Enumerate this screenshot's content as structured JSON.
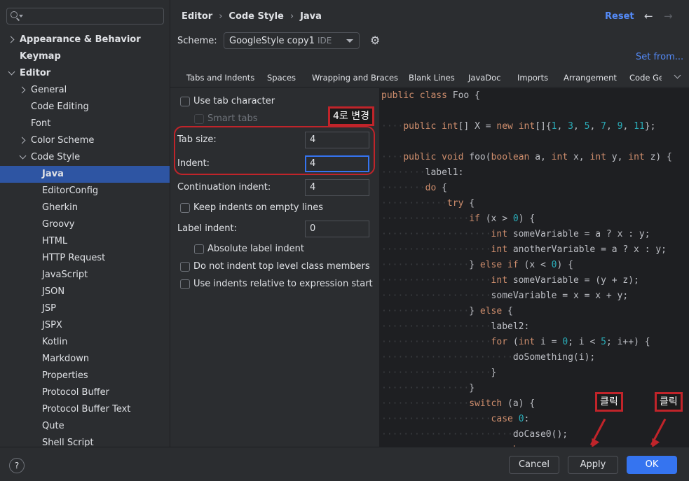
{
  "search": {
    "placeholder": ""
  },
  "sidebar": {
    "items": [
      {
        "label": "Appearance & Behavior",
        "bold": true,
        "chevron": "right",
        "level": 0
      },
      {
        "label": "Keymap",
        "bold": true,
        "chevron": "none",
        "level": 0
      },
      {
        "label": "Editor",
        "bold": true,
        "chevron": "down",
        "level": 0
      },
      {
        "label": "General",
        "chevron": "right",
        "level": 1
      },
      {
        "label": "Code Editing",
        "chevron": "none",
        "level": 1
      },
      {
        "label": "Font",
        "chevron": "none",
        "level": 1
      },
      {
        "label": "Color Scheme",
        "chevron": "right",
        "level": 1
      },
      {
        "label": "Code Style",
        "chevron": "down",
        "level": 1
      },
      {
        "label": "Java",
        "chevron": "none",
        "level": 2,
        "selected": true,
        "bold": true
      },
      {
        "label": "EditorConfig",
        "level": 2
      },
      {
        "label": "Gherkin",
        "level": 2
      },
      {
        "label": "Groovy",
        "level": 2
      },
      {
        "label": "HTML",
        "level": 2
      },
      {
        "label": "HTTP Request",
        "level": 2
      },
      {
        "label": "JavaScript",
        "level": 2
      },
      {
        "label": "JSON",
        "level": 2
      },
      {
        "label": "JSP",
        "level": 2
      },
      {
        "label": "JSPX",
        "level": 2
      },
      {
        "label": "Kotlin",
        "level": 2
      },
      {
        "label": "Markdown",
        "level": 2
      },
      {
        "label": "Properties",
        "level": 2
      },
      {
        "label": "Protocol Buffer",
        "level": 2
      },
      {
        "label": "Protocol Buffer Text",
        "level": 2
      },
      {
        "label": "Qute",
        "level": 2
      },
      {
        "label": "Shell Script",
        "level": 2
      }
    ]
  },
  "breadcrumb": {
    "part1": "Editor",
    "part2": "Code Style",
    "part3": "Java"
  },
  "header": {
    "reset": "Reset",
    "back_icon": "arrow-left-icon",
    "forward_icon": "arrow-right-icon"
  },
  "scheme": {
    "label": "Scheme:",
    "value": "GoogleStyle copy1",
    "tag": "IDE",
    "set_from": "Set from..."
  },
  "tabs": [
    "Tabs and Indents",
    "Spaces",
    "Wrapping and Braces",
    "Blank Lines",
    "JavaDoc",
    "Imports",
    "Arrangement",
    "Code Ge"
  ],
  "options": {
    "use_tab_character": "Use tab character",
    "smart_tabs": "Smart tabs",
    "tab_size_label": "Tab size:",
    "tab_size_value": "4",
    "indent_label": "Indent:",
    "indent_value": "4",
    "continuation_label": "Continuation indent:",
    "continuation_value": "4",
    "keep_indents": "Keep indents on empty lines",
    "label_indent_label": "Label indent:",
    "label_indent_value": "0",
    "absolute_label_indent": "Absolute label indent",
    "no_indent_top": "Do not indent top level class members",
    "indents_relative": "Use indents relative to expression start"
  },
  "annotations": {
    "change_to_4": "4로 변경",
    "click_apply": "클릭",
    "click_ok": "클릭",
    "color": "#c0242a"
  },
  "code_lines": [
    [
      [
        "kw",
        "public "
      ],
      [
        "kw",
        "class "
      ],
      [
        "",
        "Foo {"
      ]
    ],
    [],
    [
      [
        "dots",
        "····"
      ],
      [
        "kw",
        "public "
      ],
      [
        "kw",
        "int"
      ],
      [
        "",
        "[] X = "
      ],
      [
        "kw",
        "new "
      ],
      [
        "kw",
        "int"
      ],
      [
        "",
        "[]{"
      ],
      [
        "num",
        "1"
      ],
      [
        "",
        ", "
      ],
      [
        "num",
        "3"
      ],
      [
        "",
        ", "
      ],
      [
        "num",
        "5"
      ],
      [
        "",
        ", "
      ],
      [
        "num",
        "7"
      ],
      [
        "",
        ", "
      ],
      [
        "num",
        "9"
      ],
      [
        "",
        ", "
      ],
      [
        "num",
        "11"
      ],
      [
        "",
        "};"
      ]
    ],
    [],
    [
      [
        "dots",
        "····"
      ],
      [
        "kw",
        "public "
      ],
      [
        "kw",
        "void "
      ],
      [
        "",
        "foo("
      ],
      [
        "kw",
        "boolean "
      ],
      [
        "",
        "a, "
      ],
      [
        "kw",
        "int "
      ],
      [
        "",
        "x, "
      ],
      [
        "kw",
        "int "
      ],
      [
        "",
        "y, "
      ],
      [
        "kw",
        "int "
      ],
      [
        "",
        "z) {"
      ]
    ],
    [
      [
        "dots",
        "········"
      ],
      [
        "",
        "label1:"
      ]
    ],
    [
      [
        "dots",
        "········"
      ],
      [
        "kw",
        "do "
      ],
      [
        "",
        "{"
      ]
    ],
    [
      [
        "dots",
        "············"
      ],
      [
        "kw",
        "try "
      ],
      [
        "",
        "{"
      ]
    ],
    [
      [
        "dots",
        "················"
      ],
      [
        "kw",
        "if "
      ],
      [
        "",
        "(x > "
      ],
      [
        "num",
        "0"
      ],
      [
        "",
        ") {"
      ]
    ],
    [
      [
        "dots",
        "····················"
      ],
      [
        "kw",
        "int "
      ],
      [
        "",
        "someVariable = a ? x : y;"
      ]
    ],
    [
      [
        "dots",
        "····················"
      ],
      [
        "kw",
        "int "
      ],
      [
        "",
        "anotherVariable = a ? x : y;"
      ]
    ],
    [
      [
        "dots",
        "················"
      ],
      [
        "",
        "} "
      ],
      [
        "kw",
        "else if "
      ],
      [
        "",
        "(x < "
      ],
      [
        "num",
        "0"
      ],
      [
        "",
        ") {"
      ]
    ],
    [
      [
        "dots",
        "····················"
      ],
      [
        "kw",
        "int "
      ],
      [
        "",
        "someVariable = (y + z);"
      ]
    ],
    [
      [
        "dots",
        "····················"
      ],
      [
        "",
        "someVariable = x = x + y;"
      ]
    ],
    [
      [
        "dots",
        "················"
      ],
      [
        "",
        "} "
      ],
      [
        "kw",
        "else "
      ],
      [
        "",
        "{"
      ]
    ],
    [
      [
        "dots",
        "····················"
      ],
      [
        "",
        "label2:"
      ]
    ],
    [
      [
        "dots",
        "····················"
      ],
      [
        "kw",
        "for "
      ],
      [
        "",
        "("
      ],
      [
        "kw",
        "int "
      ],
      [
        "",
        "i = "
      ],
      [
        "num",
        "0"
      ],
      [
        "",
        "; i < "
      ],
      [
        "num",
        "5"
      ],
      [
        "",
        "; i++) {"
      ]
    ],
    [
      [
        "dots",
        "························"
      ],
      [
        "",
        "doSomething(i);"
      ]
    ],
    [
      [
        "dots",
        "····················"
      ],
      [
        "",
        "}"
      ]
    ],
    [
      [
        "dots",
        "················"
      ],
      [
        "",
        "}"
      ]
    ],
    [
      [
        "dots",
        "················"
      ],
      [
        "kw",
        "switch "
      ],
      [
        "",
        "(a) {"
      ]
    ],
    [
      [
        "dots",
        "····················"
      ],
      [
        "kw",
        "case "
      ],
      [
        "num",
        "0"
      ],
      [
        "",
        ":"
      ]
    ],
    [
      [
        "dots",
        "························"
      ],
      [
        "",
        "doCase0();"
      ]
    ],
    [
      [
        "dots",
        "························"
      ],
      [
        "kw",
        "brea"
      ]
    ]
  ],
  "footer": {
    "help": "?",
    "cancel": "Cancel",
    "apply": "Apply",
    "ok": "OK"
  },
  "colors": {
    "accent": "#3574f0",
    "link": "#548af7",
    "keyword": "#cf8e6d",
    "number": "#2aacb8",
    "selection": "#2e55a3"
  }
}
